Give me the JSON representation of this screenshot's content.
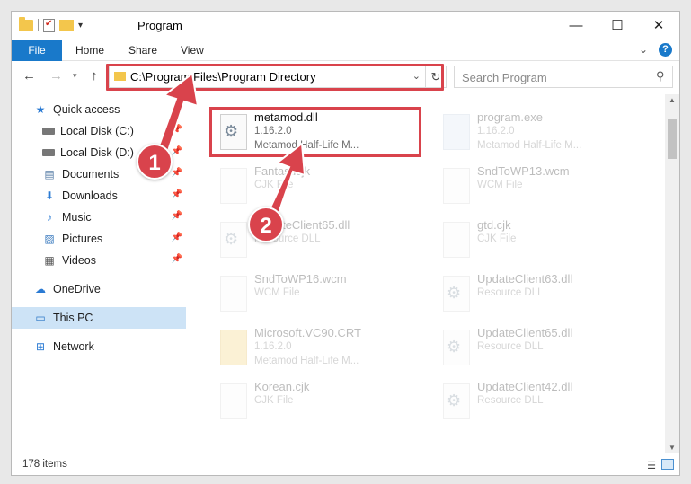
{
  "window": {
    "title": "Program",
    "minimize_icon": "minimize-icon",
    "maximize_icon": "maximize-icon",
    "close_icon": "close-icon"
  },
  "ribbon": {
    "tabs": [
      {
        "label": "File"
      },
      {
        "label": "Home"
      },
      {
        "label": "Share"
      },
      {
        "label": "View"
      }
    ],
    "expand_glyph": "⌄"
  },
  "address": {
    "path": "C:\\Program Files\\Program Directory",
    "search_placeholder": "Search Program"
  },
  "sidebar": {
    "items": [
      {
        "label": "Quick access",
        "icon": "star-icon"
      },
      {
        "label": "Local Disk (C:)",
        "icon": "drive-icon",
        "pinned": true
      },
      {
        "label": "Local Disk (D:)",
        "icon": "drive-icon",
        "pinned": true
      },
      {
        "label": "Documents",
        "icon": "documents-icon",
        "pinned": true
      },
      {
        "label": "Downloads",
        "icon": "download-icon",
        "pinned": true
      },
      {
        "label": "Music",
        "icon": "music-icon",
        "pinned": true
      },
      {
        "label": "Pictures",
        "icon": "pictures-icon",
        "pinned": true
      },
      {
        "label": "Videos",
        "icon": "videos-icon",
        "pinned": true
      },
      {
        "label": "OneDrive",
        "icon": "cloud-icon"
      },
      {
        "label": "This PC",
        "icon": "computer-icon",
        "selected": true
      },
      {
        "label": "Network",
        "icon": "network-icon"
      }
    ]
  },
  "files": [
    {
      "name": "metamod.dll",
      "line2": "1.16.2.0",
      "line3": "Metamod Half-Life M...",
      "icon": "dll-gear-icon",
      "highlighted": true
    },
    {
      "name": "program.exe",
      "line2": "1.16.2.0",
      "line3": "Metamod Half-Life M...",
      "icon": "exe-icon"
    },
    {
      "name": "Fantasticjk",
      "line2": "CJK File",
      "line3": "",
      "icon": "file-icon"
    },
    {
      "name": "SndToWP13.wcm",
      "line2": "WCM File",
      "line3": "",
      "icon": "file-icon"
    },
    {
      "name": "UpdateClient65.dll",
      "line2": "Resource DLL",
      "line3": "",
      "icon": "dll-gear-icon"
    },
    {
      "name": "gtd.cjk",
      "line2": "CJK File",
      "line3": "",
      "icon": "file-icon"
    },
    {
      "name": "SndToWP16.wcm",
      "line2": "WCM File",
      "line3": "",
      "icon": "file-icon"
    },
    {
      "name": "UpdateClient63.dll",
      "line2": "Resource DLL",
      "line3": "",
      "icon": "dll-gear-icon"
    },
    {
      "name": "Microsoft.VC90.CRT",
      "line2": "1.16.2.0",
      "line3": "Metamod Half-Life M...",
      "icon": "folder-icon"
    },
    {
      "name": "UpdateClient65.dll",
      "line2": "Resource DLL",
      "line3": "",
      "icon": "dll-gear-icon"
    },
    {
      "name": "Korean.cjk",
      "line2": "CJK File",
      "line3": "",
      "icon": "file-icon"
    },
    {
      "name": "UpdateClient42.dll",
      "line2": "Resource DLL",
      "line3": "",
      "icon": "dll-gear-icon"
    }
  ],
  "status": {
    "item_count": "178 items"
  },
  "callouts": {
    "one": "1",
    "two": "2",
    "color": "#d9434c"
  }
}
